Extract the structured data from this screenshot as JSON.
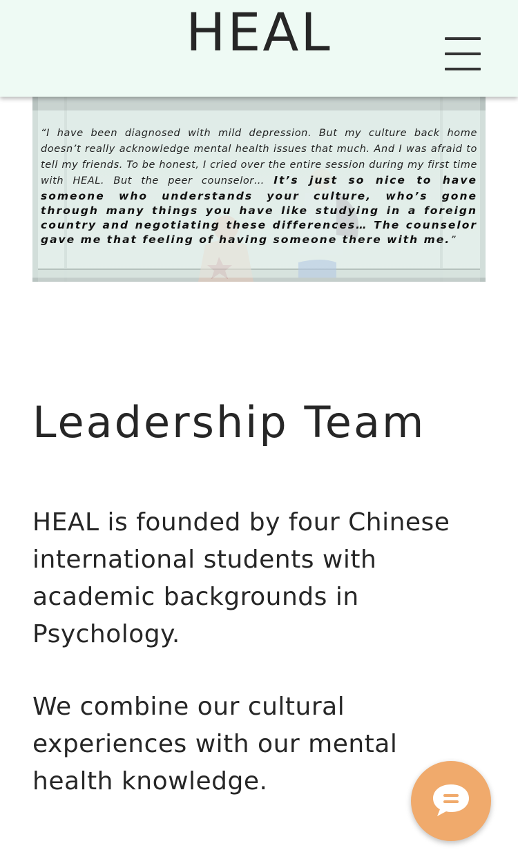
{
  "header": {
    "brand": "HEAL",
    "menu_icon": "hamburger-menu-icon"
  },
  "testimonial": {
    "quote_light": "“I have been diagnosed with mild depression. But my culture back home doesn’t really acknowledge mental health issues that much. And I was afraid to tell my friends. To be honest, I cried over the entire session during my first time with HEAL. But the peer counselor… ",
    "quote_bold": "It’s just so nice to have someone who understands your culture, who’s gone through many things you have like studying in a foreign country and negotiating these differences… The counselor gave me that feeling of having someone there with me.",
    "quote_close": "”"
  },
  "leadership": {
    "title": "Leadership Team",
    "paragraph_1": "HEAL is founded by four Chinese international students with academic backgrounds in Psychology.",
    "paragraph_2": "We combine our cultural experiences with our mental health knowledge."
  },
  "chat": {
    "icon": "chat-bubble-icon"
  },
  "colors": {
    "header_bg": "#eefaf4",
    "text": "#262626",
    "chat_button": "#f0aa6c"
  }
}
